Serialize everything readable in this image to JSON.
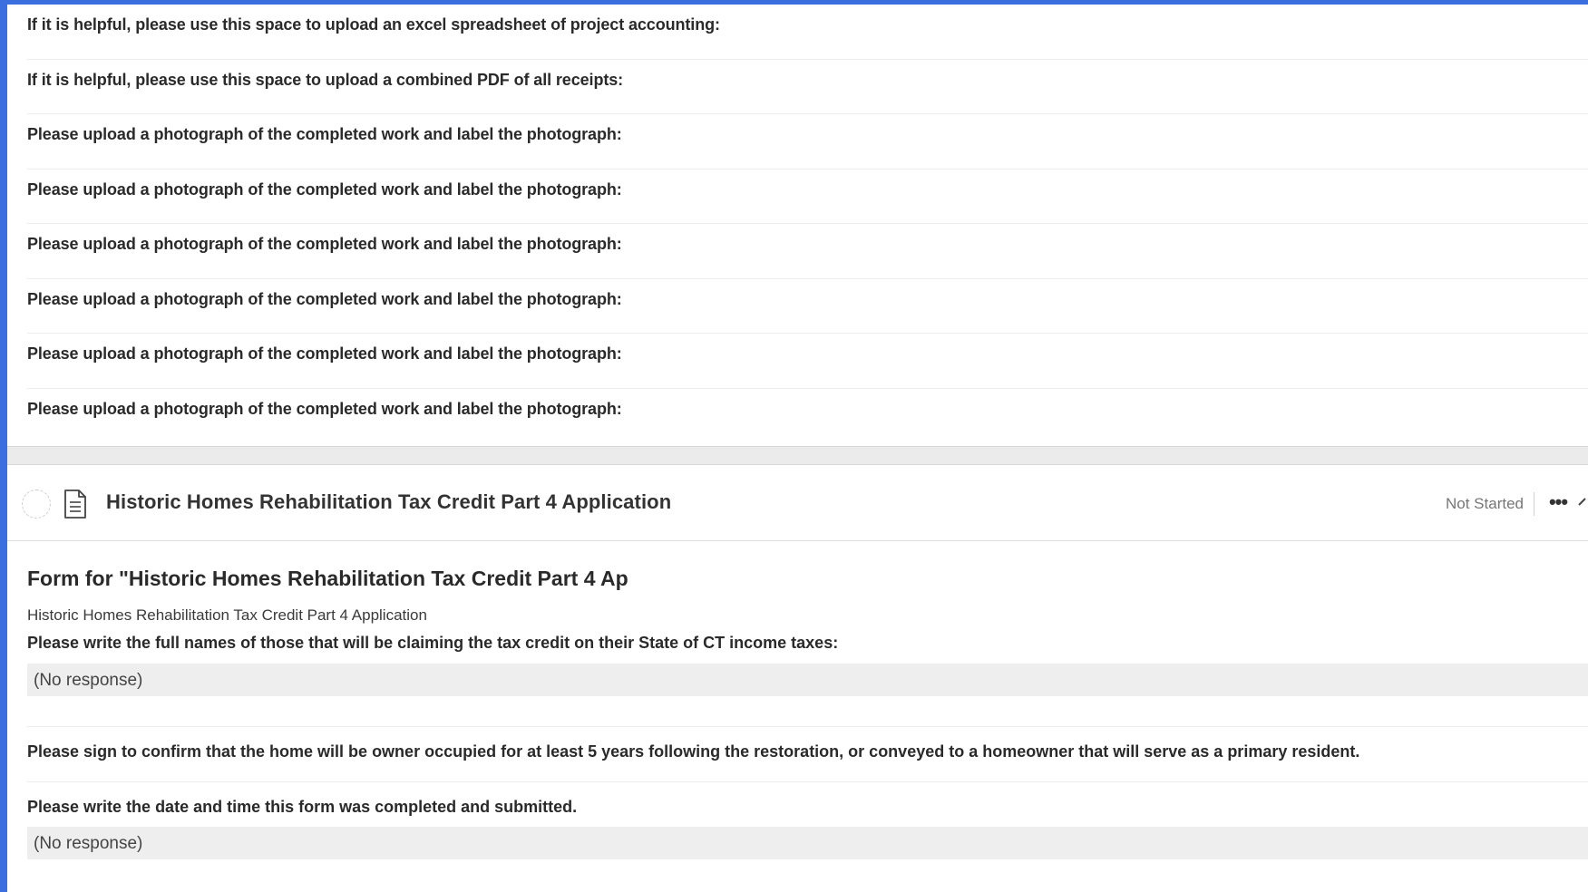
{
  "upload_questions": [
    "If it is helpful, please use this space to upload an excel spreadsheet of project accounting:",
    "If it is helpful, please use this space to upload a combined PDF of all receipts:",
    "Please upload a photograph of the completed work and label the photograph:",
    "Please upload a photograph of the completed work and label the photograph:",
    "Please upload a photograph of the completed work and label the photograph:",
    "Please upload a photograph of the completed work and label the photograph:",
    "Please upload a photograph of the completed work and label the photograph:",
    "Please upload a photograph of the completed work and label the photograph:"
  ],
  "task": {
    "title": "Historic Homes Rehabilitation Tax Credit Part 4 Application",
    "status": "Not Started",
    "more_label": "•••",
    "icons": {
      "status": "status-circle-icon",
      "document": "document-icon",
      "more": "more-icon",
      "expand": "chevron-icon"
    }
  },
  "form": {
    "title": "Form for \"Historic Homes Rehabilitation Tax Credit Part 4 Ap",
    "subtitle": "Historic Homes Rehabilitation Tax Credit Part 4 Application",
    "q1_label": "Please write the full names of those that will be claiming the tax credit on their State of CT income taxes:",
    "q1_response": "(No response)",
    "q2_label": "Please sign to confirm that the home will be owner occupied for at least 5 years following the restoration, or conveyed to a homeowner that will serve as a primary resident.",
    "q3_label": "Please write the date and time this form was completed and submitted.",
    "q3_response": "(No response)"
  },
  "colors": {
    "accent": "#3b6fe0",
    "response_bg": "#eeeeee",
    "separator": "#ebebeb"
  }
}
